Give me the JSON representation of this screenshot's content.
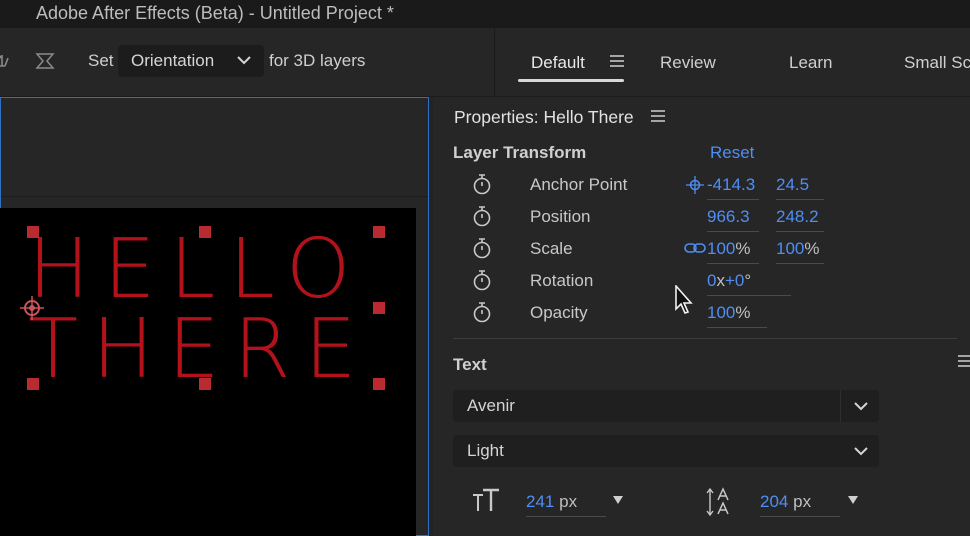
{
  "window": {
    "title": "Adobe After Effects (Beta) - Untitled Project *"
  },
  "toolbar": {
    "set_label": "Set",
    "orientation_value": "Orientation",
    "for_3d_label": "for 3D layers",
    "workspaces": [
      {
        "label": "Default"
      },
      {
        "label": "Review"
      },
      {
        "label": "Learn"
      },
      {
        "label": "Small Sc"
      }
    ]
  },
  "composition": {
    "text_lines": [
      "HELLO",
      "THERE"
    ],
    "text_color": "#b3121b"
  },
  "properties": {
    "title": "Properties: Hello There",
    "layer_transform_label": "Layer Transform",
    "reset_label": "Reset",
    "rows": [
      {
        "label": "Anchor Point",
        "v1": "-414.3",
        "v2": "24.5"
      },
      {
        "label": "Position",
        "v1": "966.3",
        "v2": "248.2"
      },
      {
        "label": "Scale",
        "v1": "100",
        "v1_unit": "%",
        "v2": "100",
        "v2_unit": "%"
      },
      {
        "label": "Rotation",
        "v1": "0",
        "v1_x": "x",
        "v1b": "+0",
        "v1_unit": "°"
      },
      {
        "label": "Opacity",
        "v1": "100",
        "v1_unit": "%"
      }
    ],
    "text_section_label": "Text",
    "font_family": "Avenir",
    "font_style": "Light",
    "font_size": "241",
    "font_size_unit": "px",
    "leading": "204",
    "leading_unit": "px"
  },
  "colors": {
    "accent": "#4f8ef5",
    "panel_focus": "#2f6fc4"
  }
}
